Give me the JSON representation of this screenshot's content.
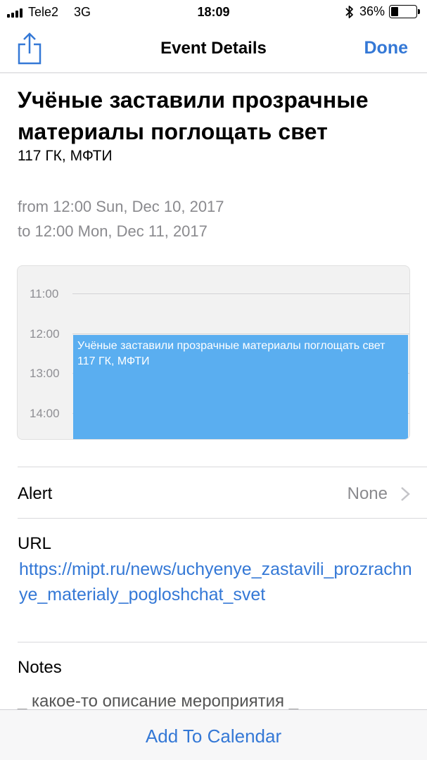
{
  "status_bar": {
    "carrier": "Tele2",
    "network": "3G",
    "time": "18:09",
    "battery": "36%"
  },
  "nav": {
    "title": "Event Details",
    "done_label": "Done",
    "share_icon": "share-icon"
  },
  "event": {
    "title": "Учёные заставили прозрачные материалы поглощать свет",
    "location": "117 ГК, МФТИ",
    "from": "from 12:00 Sun, Dec 10, 2017",
    "to": "to 12:00 Mon, Dec 11, 2017"
  },
  "day_view": {
    "hours": [
      "11:00",
      "12:00",
      "13:00",
      "14:00"
    ],
    "block_title": "Учёные заставили прозрачные материалы поглощать свет",
    "block_location": "117 ГК, МФТИ",
    "block_color": "#5aaef0"
  },
  "alert": {
    "label": "Alert",
    "value": "None"
  },
  "url": {
    "label": "URL",
    "value": "https://mipt.ru/news/uchyenye_zastavili_prozrachnye_materialy_pogloshchat_svet"
  },
  "notes": {
    "label": "Notes",
    "value": "_ какое-то описание мероприятия _"
  },
  "toolbar": {
    "add_label": "Add To Calendar"
  },
  "colors": {
    "accent": "#3478d6",
    "secondary_text": "#8a8a8e"
  }
}
